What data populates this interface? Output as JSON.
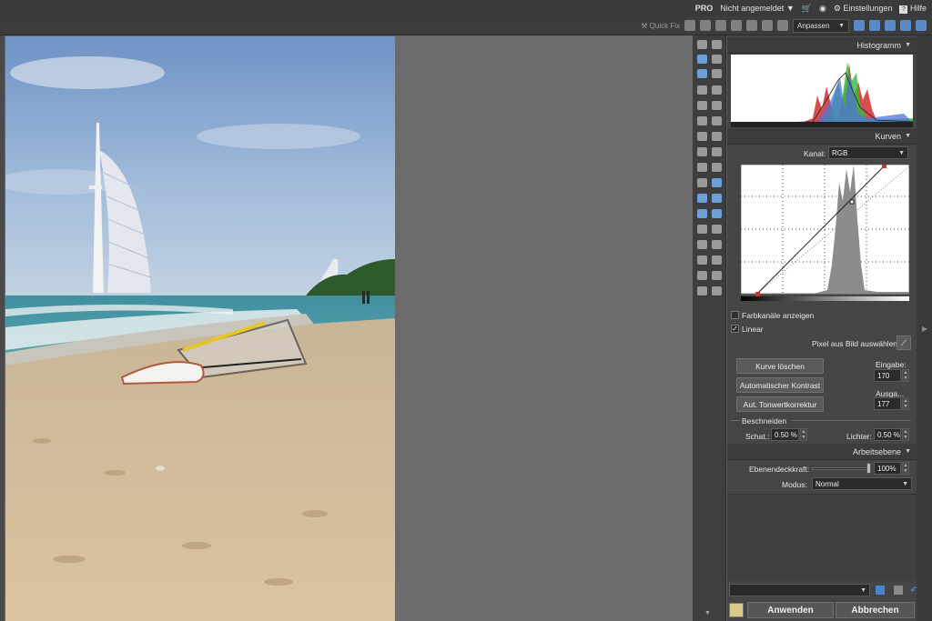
{
  "topbar": {
    "pro": "PRO",
    "login": "Nicht angemeldet",
    "settings": "Einstellungen",
    "help": "Hilfe"
  },
  "toolbar": {
    "quickfix": "Quick Fix",
    "zoom_mode": "Anpassen"
  },
  "histogram": {
    "title": "Histogramm"
  },
  "curves": {
    "title": "Kurven",
    "channel_label": "Kanal:",
    "channel_value": "RGB",
    "show_channels": "Farbkanäle anzeigen",
    "show_channels_checked": false,
    "linear": "Linear",
    "linear_checked": true,
    "pick_pixel": "Pixel aus Bild auswählen:",
    "clear_curve": "Kurve löschen",
    "auto_contrast": "Automatischer Kontrast",
    "auto_levels": "Aut. Tonwertkorrektur",
    "input_label": "Eingabe:",
    "input_value": "170",
    "output_label": "Ausga...",
    "output_value": "177",
    "clip_title": "Beschneiden",
    "shadows_label": "Schat.:",
    "shadows_value": "0.50 %",
    "highlights_label": "Lichter:",
    "highlights_value": "0.50 %"
  },
  "layer": {
    "title": "Arbeitsebene",
    "opacity_label": "Ebenendeckkraft:",
    "opacity_value": "100%",
    "opacity_level": 1.0,
    "mode_label": "Modus:",
    "mode_value": "Normal"
  },
  "footer": {
    "apply": "Anwenden",
    "cancel": "Abbrechen"
  },
  "colors": {
    "accent_blue": "#6ea0d8",
    "curve_point": "#c0392b"
  }
}
